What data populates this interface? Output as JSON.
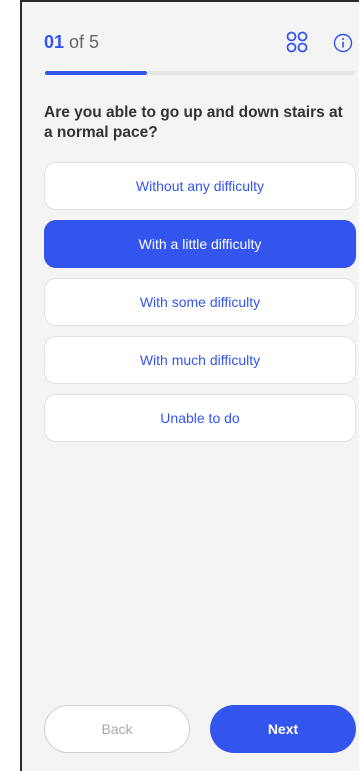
{
  "header": {
    "current": "01",
    "of_total": " of 5",
    "progress": 0.33,
    "grid_icon": "grid-icon",
    "info_icon": "info-icon"
  },
  "question": {
    "text": "Are you able to go up and down stairs at a normal pace?"
  },
  "options": [
    {
      "label": "Without any difficulty",
      "selected": false
    },
    {
      "label": "With a little difficulty",
      "selected": true
    },
    {
      "label": "With some difficulty",
      "selected": false
    },
    {
      "label": "With much difficulty",
      "selected": false
    },
    {
      "label": "Unable to do",
      "selected": false
    }
  ],
  "footer": {
    "back_label": "Back",
    "next_label": "Next"
  },
  "colors": {
    "accent": "#3355ee",
    "background": "#f4f4f5",
    "option_background": "#ffffff"
  }
}
